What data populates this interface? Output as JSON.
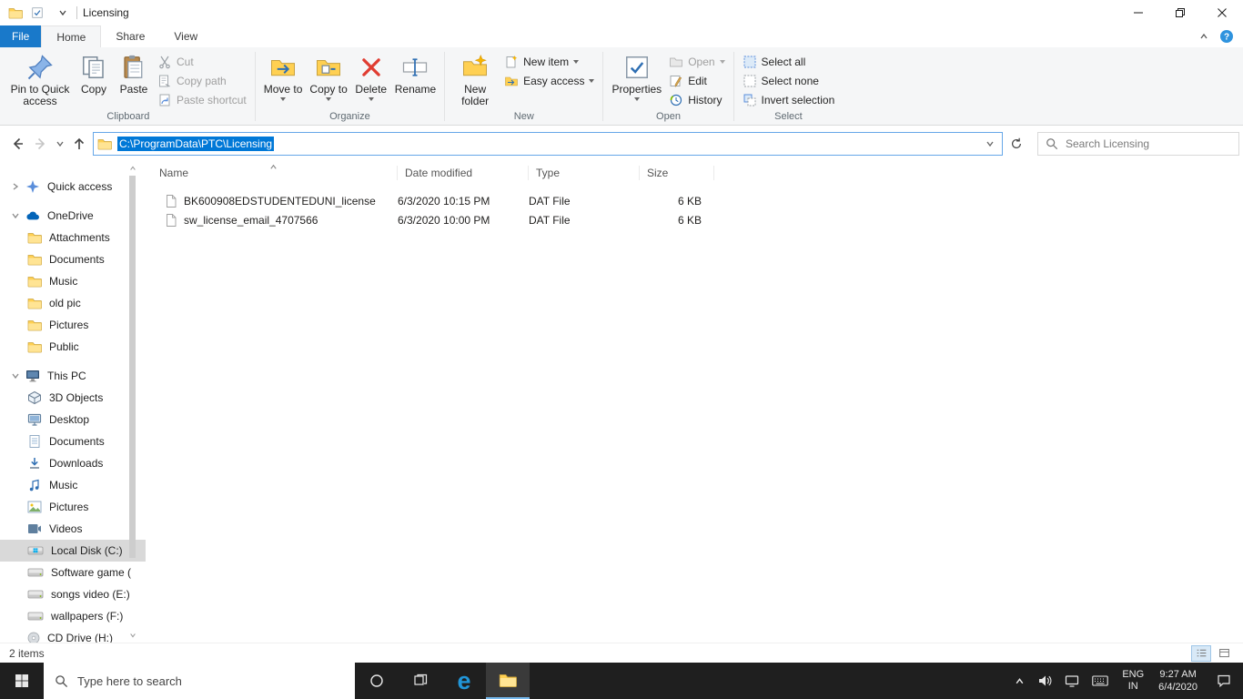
{
  "titlebar": {
    "title": "Licensing"
  },
  "tabs": {
    "file": "File",
    "home": "Home",
    "share": "Share",
    "view": "View"
  },
  "ribbon": {
    "pin": "Pin to Quick access",
    "copy": "Copy",
    "paste": "Paste",
    "cut": "Cut",
    "copy_path": "Copy path",
    "paste_shortcut": "Paste shortcut",
    "group_clipboard": "Clipboard",
    "move_to": "Move to",
    "copy_to": "Copy to",
    "delete": "Delete",
    "rename": "Rename",
    "group_organize": "Organize",
    "new_folder": "New folder",
    "new_item": "New item",
    "easy_access": "Easy access",
    "group_new": "New",
    "properties": "Properties",
    "open": "Open",
    "edit": "Edit",
    "history": "History",
    "group_open": "Open",
    "select_all": "Select all",
    "select_none": "Select none",
    "invert_selection": "Invert selection",
    "group_select": "Select"
  },
  "navbar": {
    "path": "C:\\ProgramData\\PTC\\Licensing",
    "search_placeholder": "Search Licensing"
  },
  "sidebar": {
    "quick_access": "Quick access",
    "onedrive": "OneDrive",
    "onedrive_items": [
      "Attachments",
      "Documents",
      "Music",
      "old pic",
      "Pictures",
      "Public"
    ],
    "this_pc": "This PC",
    "pc_items": [
      "3D Objects",
      "Desktop",
      "Documents",
      "Downloads",
      "Music",
      "Pictures",
      "Videos",
      "Local Disk (C:)",
      "Software game (",
      "songs video (E:)",
      "wallpapers (F:)",
      "CD Drive (H:)"
    ]
  },
  "filelist": {
    "columns": {
      "name": "Name",
      "date_modified": "Date modified",
      "type": "Type",
      "size": "Size"
    },
    "rows": [
      {
        "name": "BK600908EDSTUDENTEDUNI_license",
        "date_modified": "6/3/2020 10:15 PM",
        "type": "DAT File",
        "size": "6 KB"
      },
      {
        "name": "sw_license_email_4707566",
        "date_modified": "6/3/2020 10:00 PM",
        "type": "DAT File",
        "size": "6 KB"
      }
    ]
  },
  "statusbar": {
    "count": "2 items"
  },
  "taskbar": {
    "search_placeholder": "Type here to search",
    "language": "ENG",
    "region": "IN",
    "time": "9:27 AM",
    "date": "6/4/2020"
  }
}
